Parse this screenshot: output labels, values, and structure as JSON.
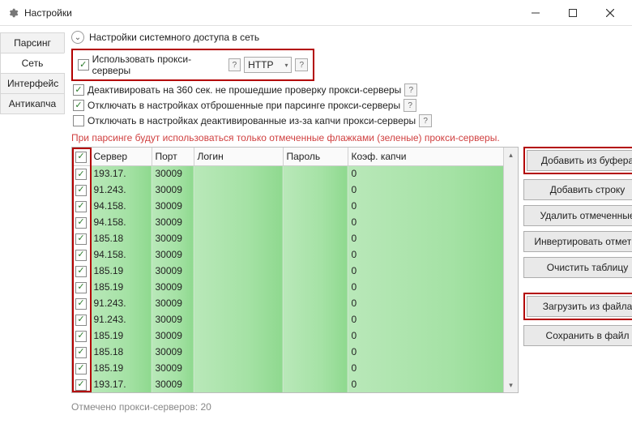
{
  "window": {
    "title": "Настройки"
  },
  "tabs": [
    "Парсинг",
    "Сеть",
    "Интерфейс",
    "Антикапча"
  ],
  "active_tab_index": 1,
  "group": {
    "header": "Настройки системного доступа в сеть"
  },
  "options": {
    "use_proxy": {
      "label": "Использовать прокси-серверы",
      "checked": true,
      "type": "HTTP"
    },
    "deactivate_360": {
      "label": "Деактивировать на 360 сек. не прошедшие проверку прокси-серверы",
      "checked": true
    },
    "disable_parse": {
      "label": "Отключать в настройках отброшенные при парсинге прокси-серверы",
      "checked": true
    },
    "disable_captcha": {
      "label": "Отключать в настройках деактивированные из-за капчи прокси-серверы",
      "checked": false
    }
  },
  "warning": "При парсинге будут использоваться только отмеченные флажками (зеленые) прокси-серверы.",
  "columns": {
    "server": "Сервер",
    "port": "Порт",
    "login": "Логин",
    "password": "Пароль",
    "captcha": "Коэф. капчи"
  },
  "rows": [
    {
      "checked": true,
      "server": "193.17.",
      "port": "30009",
      "login": "",
      "password": "",
      "captcha": "0"
    },
    {
      "checked": true,
      "server": "91.243.",
      "port": "30009",
      "login": "",
      "password": "",
      "captcha": "0"
    },
    {
      "checked": true,
      "server": "94.158.",
      "port": "30009",
      "login": "",
      "password": "",
      "captcha": "0"
    },
    {
      "checked": true,
      "server": "94.158.",
      "port": "30009",
      "login": "",
      "password": "",
      "captcha": "0"
    },
    {
      "checked": true,
      "server": "185.18",
      "port": "30009",
      "login": "",
      "password": "",
      "captcha": "0"
    },
    {
      "checked": true,
      "server": "94.158.",
      "port": "30009",
      "login": "",
      "password": "",
      "captcha": "0"
    },
    {
      "checked": true,
      "server": "185.19",
      "port": "30009",
      "login": "",
      "password": "",
      "captcha": "0"
    },
    {
      "checked": true,
      "server": "185.19",
      "port": "30009",
      "login": "",
      "password": "",
      "captcha": "0"
    },
    {
      "checked": true,
      "server": "91.243.",
      "port": "30009",
      "login": "",
      "password": "",
      "captcha": "0"
    },
    {
      "checked": true,
      "server": "91.243.",
      "port": "30009",
      "login": "",
      "password": "",
      "captcha": "0"
    },
    {
      "checked": true,
      "server": "185.19",
      "port": "30009",
      "login": "",
      "password": "",
      "captcha": "0"
    },
    {
      "checked": true,
      "server": "185.18",
      "port": "30009",
      "login": "",
      "password": "",
      "captcha": "0"
    },
    {
      "checked": true,
      "server": "185.19",
      "port": "30009",
      "login": "",
      "password": "",
      "captcha": "0"
    },
    {
      "checked": true,
      "server": "193.17.",
      "port": "30009",
      "login": "",
      "password": "",
      "captcha": "0"
    }
  ],
  "header_checked": true,
  "buttons": {
    "add_buffer": "Добавить из буфера",
    "add_row": "Добавить строку",
    "delete_marked": "Удалить отмеченные",
    "invert": "Инвертировать отметку",
    "clear": "Очистить таблицу",
    "load_file": "Загрузить из файла",
    "save_file": "Сохранить в файл"
  },
  "status": "Отмечено прокси-серверов: 20"
}
